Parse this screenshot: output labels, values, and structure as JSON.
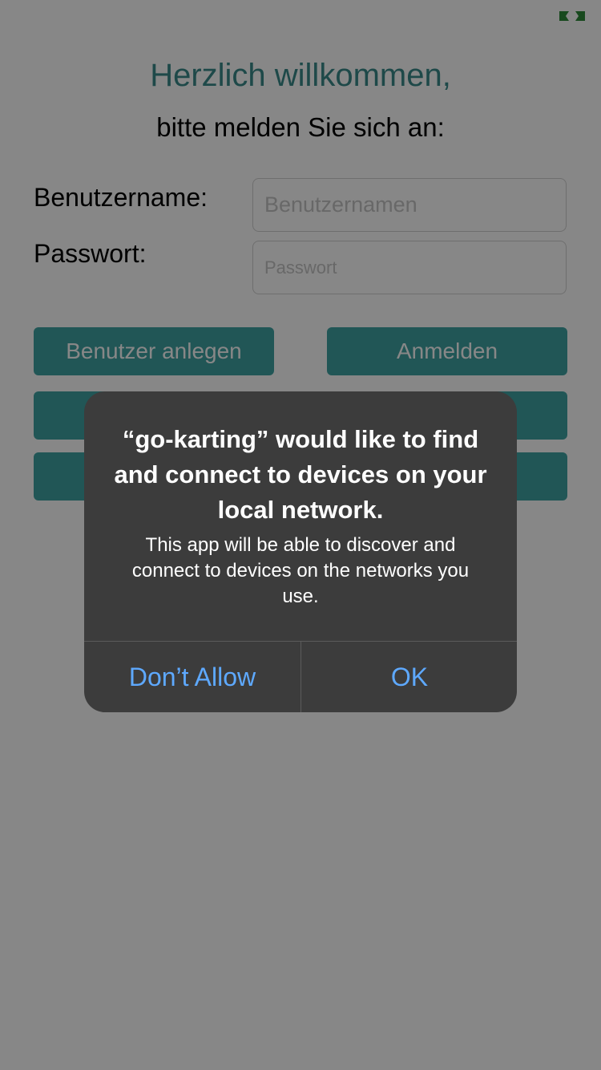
{
  "header": {
    "title": "Herzlich willkommen,",
    "subtitle": "bitte melden Sie sich an:"
  },
  "form": {
    "username_label": "Benutzername:",
    "username_placeholder": "Benutzernamen",
    "password_label": "Passwort:",
    "password_placeholder": "Passwort"
  },
  "buttons": {
    "create_user": "Benutzer anlegen",
    "login": "Anmelden"
  },
  "alert": {
    "title": "“go-karting” would like to find and connect to devices on your local network.",
    "message": "This app will be able to discover and connect to devices on the networks you use.",
    "deny_label": "Don’t Allow",
    "ok_label": "OK"
  },
  "status": {
    "icon": "screen-mirroring-icon",
    "icon_color": "#2e8b3a"
  },
  "colors": {
    "accent": "#3fa3a3",
    "title_color": "#3a8a8a",
    "alert_bg": "#3c3c3c",
    "alert_button": "#5ea9ff"
  }
}
